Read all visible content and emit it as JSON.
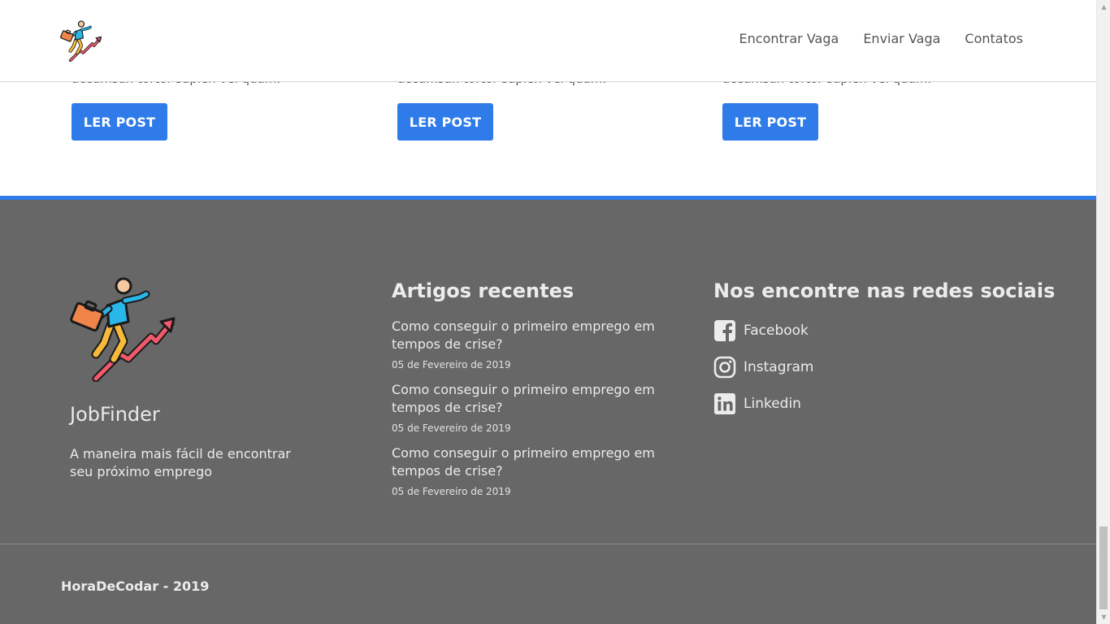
{
  "header": {
    "nav": [
      {
        "label": "Encontrar Vaga"
      },
      {
        "label": "Enviar Vaga"
      },
      {
        "label": "Contatos"
      }
    ]
  },
  "posts": [
    {
      "excerpt": "accumsan tortor sapien vel quam.",
      "button": "LER POST"
    },
    {
      "excerpt": "accumsan tortor sapien vel quam.",
      "button": "LER POST"
    },
    {
      "excerpt": "accumsan tortor sapien vel quam.",
      "button": "LER POST"
    }
  ],
  "footer": {
    "brand": {
      "name": "JobFinder",
      "tagline": "A maneira mais fácil de encontrar seu próximo emprego"
    },
    "articles": {
      "title": "Artigos recentes",
      "items": [
        {
          "title": "Como conseguir o primeiro emprego em tempos de crise?",
          "date": "05 de Fevereiro de 2019"
        },
        {
          "title": "Como conseguir o primeiro emprego em tempos de crise?",
          "date": "05 de Fevereiro de 2019"
        },
        {
          "title": "Como conseguir o primeiro emprego em tempos de crise?",
          "date": "05 de Fevereiro de 2019"
        }
      ]
    },
    "social": {
      "title": "Nos encontre nas redes sociais",
      "items": [
        {
          "label": "Facebook",
          "icon": "facebook-icon"
        },
        {
          "label": "Instagram",
          "icon": "instagram-icon"
        },
        {
          "label": "Linkedin",
          "icon": "linkedin-icon"
        }
      ]
    },
    "copyright": "HoraDeCodar - 2019"
  },
  "colors": {
    "accent": "#2f7bea",
    "footer_bg": "#676767"
  }
}
